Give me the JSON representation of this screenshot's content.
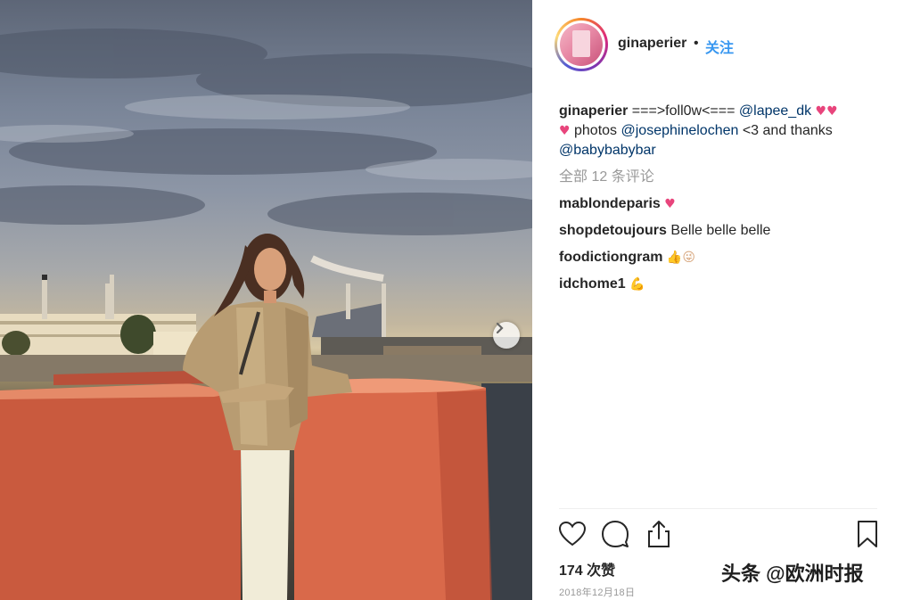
{
  "header": {
    "username": "ginaperier",
    "separator": "•",
    "follow_label": "关注"
  },
  "caption": {
    "username": "ginaperier",
    "text_1": " ===>foll0w<=== ",
    "mention_1": "@lapee_dk",
    "hearts_1": " ♥♥",
    "hearts_2": "♥",
    "text_2": " photos ",
    "mention_2": "@josephinelochen",
    "text_3": " <3 and thanks ",
    "mention_3": "@babybabybar"
  },
  "all_comments_label": "全部 12 条评论",
  "comments": [
    {
      "username": "mablondeparis",
      "text": "",
      "emoji": "♥"
    },
    {
      "username": "shopdetoujours",
      "text": "Belle belle belle",
      "emoji": ""
    },
    {
      "username": "foodictiongram",
      "text": "",
      "emoji": "👍😜"
    },
    {
      "username": "idchome1",
      "text": "",
      "emoji": "💪"
    }
  ],
  "icons": {
    "like": "heart-icon",
    "comment": "comment-icon",
    "share": "share-icon",
    "save": "bookmark-icon",
    "next": "chevron-right-icon"
  },
  "likes_label": "174 次赞",
  "date_label": "2018年12月18日",
  "watermark": "头条 @欧洲时报",
  "colors": {
    "follow": "#3897f0",
    "mention": "#003569",
    "muted": "#999999",
    "wall": "#d9694a"
  }
}
